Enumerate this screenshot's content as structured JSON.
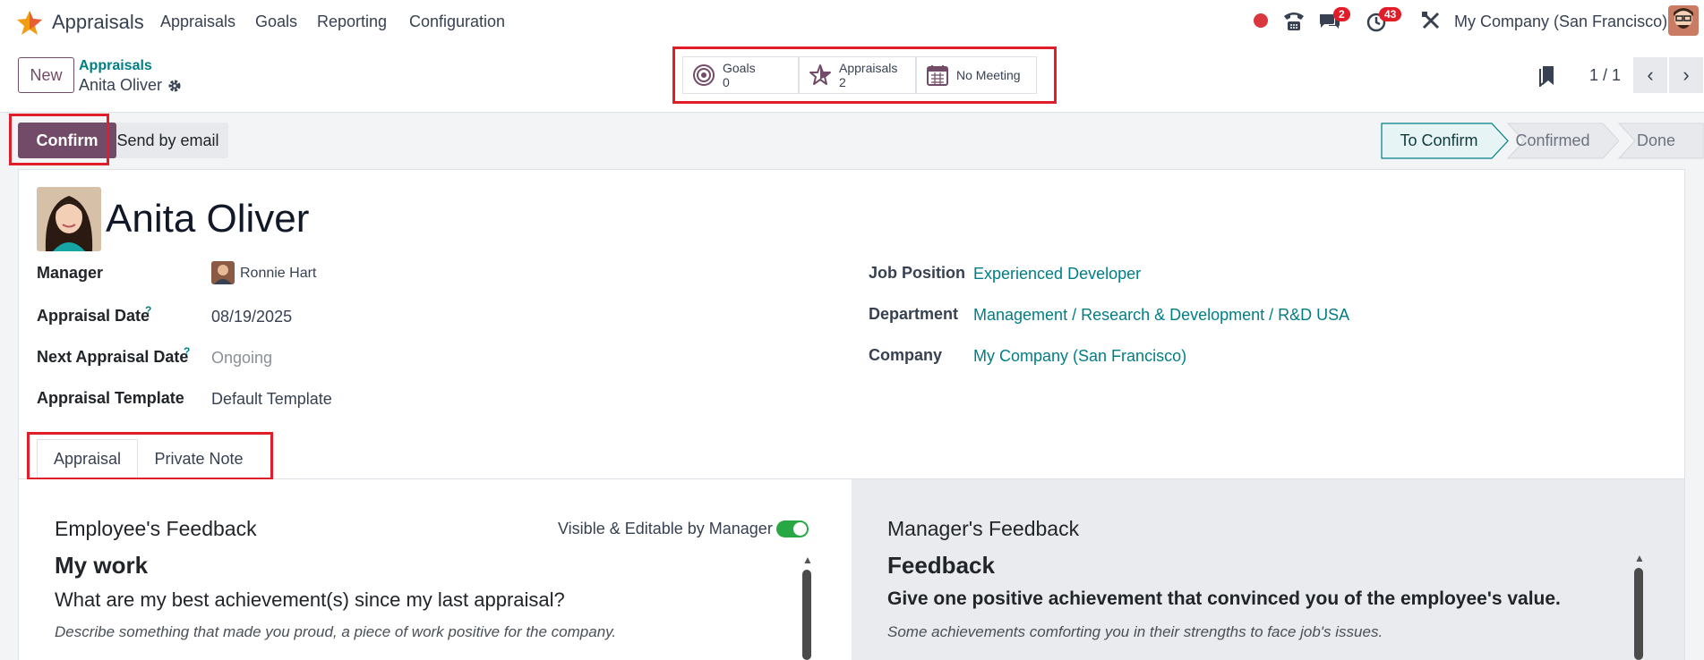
{
  "app": {
    "brand": "Appraisals",
    "menu": [
      "Appraisals",
      "Goals",
      "Reporting",
      "Configuration"
    ],
    "company": "My Company (San Francisco)",
    "messages_badge": "2",
    "activities_badge": "43"
  },
  "control_panel": {
    "new_label": "New",
    "breadcrumb_parent": "Appraisals",
    "breadcrumb_current": "Anita Oliver",
    "pager": "1 / 1",
    "smart_buttons": {
      "goals_label": "Goals",
      "goals_count": "0",
      "appraisals_label": "Appraisals",
      "appraisals_count": "2",
      "meeting_label": "No Meeting"
    }
  },
  "actions": {
    "confirm": "Confirm",
    "send_email": "Send by email"
  },
  "stages": [
    "To Confirm",
    "Confirmed",
    "Done"
  ],
  "record": {
    "name": "Anita Oliver",
    "manager_label": "Manager",
    "manager": "Ronnie Hart",
    "appraisal_date_label": "Appraisal Date",
    "appraisal_date": "08/19/2025",
    "next_date_label": "Next Appraisal Date",
    "next_date": "Ongoing",
    "template_label": "Appraisal Template",
    "template": "Default Template",
    "job_label": "Job Position",
    "job": "Experienced Developer",
    "dept_label": "Department",
    "dept": "Management / Research & Development / R&D USA",
    "company_label": "Company",
    "company": "My Company (San Francisco)",
    "help_mark": "?"
  },
  "tabs": [
    "Appraisal",
    "Private Note"
  ],
  "employee_feedback": {
    "title": "Employee's Feedback",
    "toggle_label": "Visible & Editable by Manager",
    "heading": "My work",
    "question": "What are my best achievement(s) since my last appraisal?",
    "description": "Describe something that made you proud, a piece of work positive for the company."
  },
  "manager_feedback": {
    "title": "Manager's Feedback",
    "heading": "Feedback",
    "question": "Give one positive achievement that convinced you of the employee's value.",
    "description": "Some achievements comforting you in their strengths to face job's issues."
  },
  "colors": {
    "brand": "#714b67",
    "link": "#017e84",
    "highlight": "#e11d2a"
  }
}
